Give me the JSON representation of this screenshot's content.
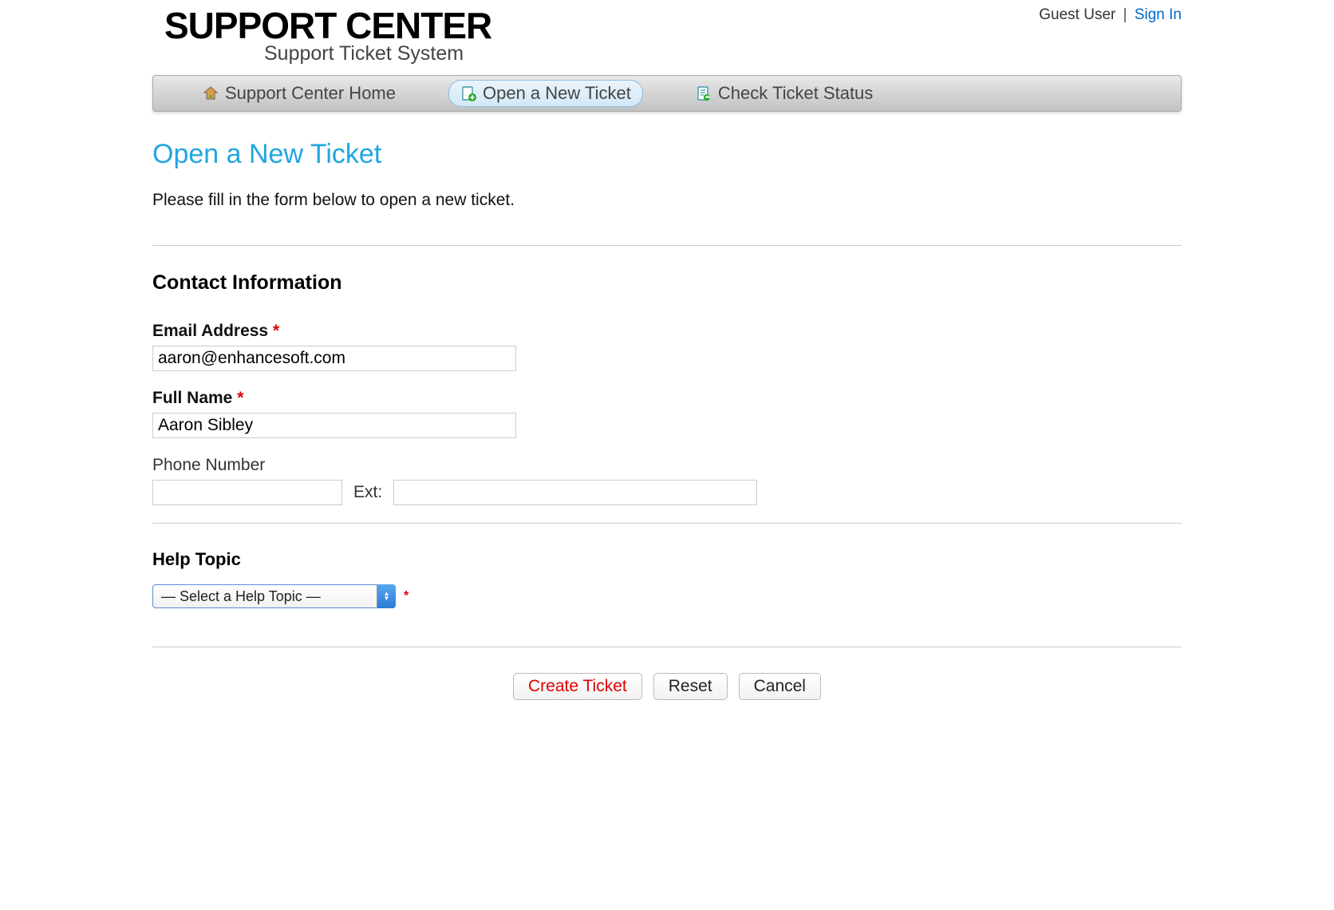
{
  "header": {
    "logo_main": "SUPPORT CENTER",
    "logo_sub": "Support Ticket System",
    "user_label": "Guest User",
    "sign_in_label": "Sign In"
  },
  "nav": {
    "home_label": "Support Center Home",
    "open_label": "Open a New Ticket",
    "status_label": "Check Ticket Status"
  },
  "page": {
    "title": "Open a New Ticket",
    "intro": "Please fill in the form below to open a new ticket.",
    "section_contact": "Contact Information",
    "required_mark": "*"
  },
  "form": {
    "email_label": "Email Address",
    "email_value": "aaron@enhancesoft.com",
    "name_label": "Full Name",
    "name_value": "Aaron Sibley",
    "phone_label": "Phone Number",
    "phone_value": "",
    "ext_label": "Ext:",
    "ext_value": "",
    "help_topic_label": "Help Topic",
    "help_topic_placeholder": "— Select a Help Topic —"
  },
  "buttons": {
    "create": "Create Ticket",
    "reset": "Reset",
    "cancel": "Cancel"
  }
}
